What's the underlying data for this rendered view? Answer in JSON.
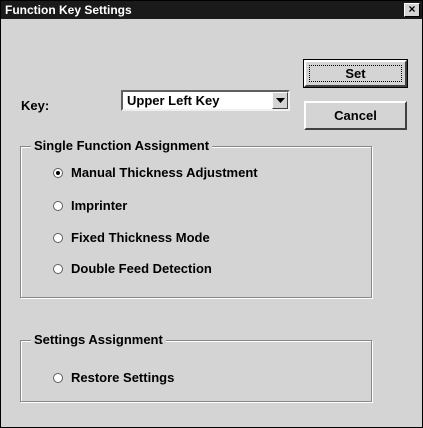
{
  "window": {
    "title": "Function Key Settings",
    "close_glyph": "×"
  },
  "key": {
    "label": "Key:",
    "selected": "Upper Left Key",
    "arrow_icon": "chevron-down-icon"
  },
  "buttons": {
    "set": "Set",
    "cancel": "Cancel"
  },
  "single_function": {
    "legend": "Single Function Assignment",
    "options": [
      {
        "label": "Manual Thickness Adjustment",
        "selected": true
      },
      {
        "label": "Imprinter",
        "selected": false
      },
      {
        "label": "Fixed Thickness Mode",
        "selected": false
      },
      {
        "label": "Double Feed Detection",
        "selected": false
      }
    ]
  },
  "settings_assignment": {
    "legend": "Settings Assignment",
    "options": [
      {
        "label": "Restore Settings",
        "selected": false
      }
    ]
  }
}
